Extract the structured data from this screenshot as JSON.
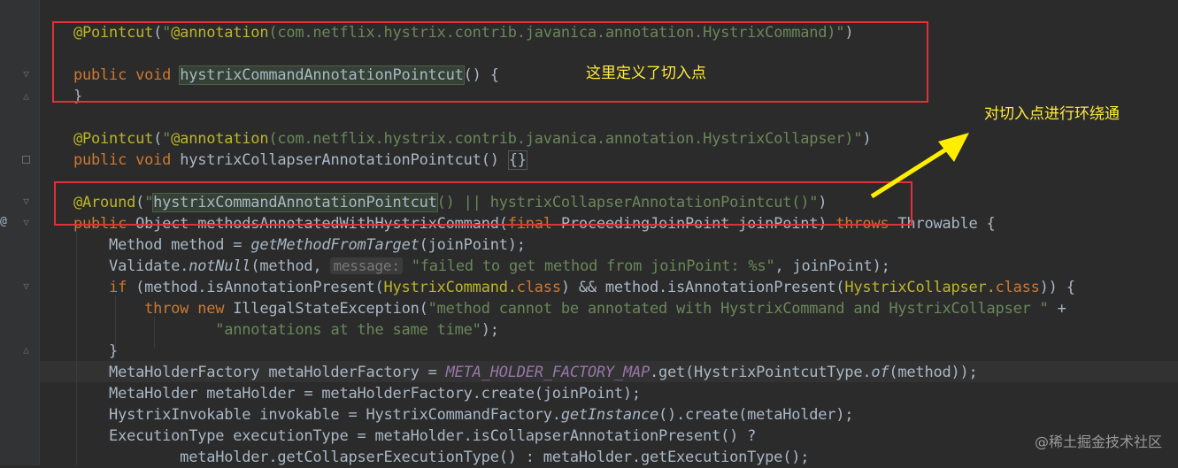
{
  "editor": {
    "gutter_marker": "@",
    "lines": [
      {
        "id": "l1",
        "tokens": [
          {
            "t": "@Pointcut",
            "c": "ann"
          },
          {
            "t": "(",
            "c": ""
          },
          {
            "t": "\"",
            "c": "str"
          },
          {
            "t": "@annotation",
            "c": "ann"
          },
          {
            "t": "(com.netflix.hystrix.contrib.javanica.annotation.HystrixCommand)",
            "c": "str"
          },
          {
            "t": "\"",
            "c": "str"
          },
          {
            "t": ")",
            "c": ""
          }
        ]
      },
      {
        "id": "l3",
        "tokens": [
          {
            "t": "public void ",
            "c": "kw"
          },
          {
            "t": "hystrixCommandAnnotationPointcut",
            "c": "hl"
          },
          {
            "t": "() {",
            "c": ""
          }
        ]
      },
      {
        "id": "l4",
        "tokens": [
          {
            "t": "}",
            "c": ""
          }
        ]
      },
      {
        "id": "l6",
        "tokens": [
          {
            "t": "@Pointcut",
            "c": "ann"
          },
          {
            "t": "(",
            "c": ""
          },
          {
            "t": "\"",
            "c": "str"
          },
          {
            "t": "@annotation",
            "c": "ann"
          },
          {
            "t": "(com.netflix.hystrix.contrib.javanica.annotation.HystrixCollapser)",
            "c": "str"
          },
          {
            "t": "\"",
            "c": "str"
          },
          {
            "t": ")",
            "c": ""
          }
        ]
      },
      {
        "id": "l7",
        "tokens": [
          {
            "t": "public void ",
            "c": "kw"
          },
          {
            "t": "hystrixCollapserAnnotationPointcut() ",
            "c": ""
          },
          {
            "t": "{}",
            "c": "brace"
          }
        ]
      },
      {
        "id": "l9",
        "tokens": [
          {
            "t": "@Around",
            "c": "ann"
          },
          {
            "t": "(",
            "c": ""
          },
          {
            "t": "\"",
            "c": "str"
          },
          {
            "t": "hystrixCommandAnnotationPointcut",
            "c": "hl"
          },
          {
            "t": "() || hystrixCollapserAnnotationPointcut()",
            "c": "str"
          },
          {
            "t": "\"",
            "c": "str"
          },
          {
            "t": ")",
            "c": ""
          }
        ]
      },
      {
        "id": "l10",
        "tokens": [
          {
            "t": "public ",
            "c": "kw"
          },
          {
            "t": "Object methodsAnnotatedWithHystrixCommand(",
            "c": ""
          },
          {
            "t": "final ",
            "c": "kw"
          },
          {
            "t": "ProceedingJoinPoint joinPoint) ",
            "c": ""
          },
          {
            "t": "throws ",
            "c": "kw"
          },
          {
            "t": "Throwable {",
            "c": ""
          }
        ]
      },
      {
        "id": "l11",
        "tokens": [
          {
            "t": "    Method method = ",
            "c": ""
          },
          {
            "t": "getMethodFromTarget",
            "c": "ital"
          },
          {
            "t": "(joinPoint);",
            "c": ""
          }
        ]
      },
      {
        "id": "l12",
        "tokens": [
          {
            "t": "    Validate.",
            "c": ""
          },
          {
            "t": "notNull",
            "c": "ital"
          },
          {
            "t": "(method, ",
            "c": ""
          },
          {
            "t": "message:",
            "c": "hint"
          },
          {
            "t": " ",
            "c": ""
          },
          {
            "t": "\"failed to get method from joinPoint: %s\"",
            "c": "str"
          },
          {
            "t": ", joinPoint);",
            "c": ""
          }
        ]
      },
      {
        "id": "l13",
        "tokens": [
          {
            "t": "    ",
            "c": ""
          },
          {
            "t": "if ",
            "c": "kw"
          },
          {
            "t": "(method.isAnnotationPresent(",
            "c": ""
          },
          {
            "t": "HystrixCommand.",
            "c": "ann"
          },
          {
            "t": "class",
            "c": "kw"
          },
          {
            "t": ") && method.isAnnotationPresent(",
            "c": ""
          },
          {
            "t": "HystrixCollapser.",
            "c": "ann"
          },
          {
            "t": "class",
            "c": "kw"
          },
          {
            "t": ")) {",
            "c": ""
          }
        ]
      },
      {
        "id": "l14",
        "tokens": [
          {
            "t": "        ",
            "c": ""
          },
          {
            "t": "throw new ",
            "c": "kw"
          },
          {
            "t": "IllegalStateException(",
            "c": ""
          },
          {
            "t": "\"method cannot be annotated with HystrixCommand and HystrixCollapser \"",
            "c": "str"
          },
          {
            "t": " +",
            "c": ""
          }
        ]
      },
      {
        "id": "l15",
        "tokens": [
          {
            "t": "                ",
            "c": ""
          },
          {
            "t": "\"annotations at the same time\"",
            "c": "str"
          },
          {
            "t": ");",
            "c": ""
          }
        ]
      },
      {
        "id": "l16",
        "tokens": [
          {
            "t": "    }",
            "c": ""
          }
        ]
      },
      {
        "id": "l17",
        "tokens": [
          {
            "t": "    MetaHolderFactory metaHolderFactory ",
            "c": ""
          },
          {
            "t": "= ",
            "c": ""
          },
          {
            "t": "META_HOLDER_FACTORY_MAP",
            "c": "const"
          },
          {
            "t": ".get(HystrixPointcutType.",
            "c": ""
          },
          {
            "t": "of",
            "c": "ital"
          },
          {
            "t": "(method));",
            "c": ""
          }
        ]
      },
      {
        "id": "l18",
        "tokens": [
          {
            "t": "    MetaHolder metaHolder = metaHolderFactory.create(joinPoint);",
            "c": ""
          }
        ]
      },
      {
        "id": "l19",
        "tokens": [
          {
            "t": "    HystrixInvokable invokable = HystrixCommandFactory.",
            "c": ""
          },
          {
            "t": "getInstance",
            "c": "ital"
          },
          {
            "t": "().create(metaHolder);",
            "c": ""
          }
        ]
      },
      {
        "id": "l20",
        "tokens": [
          {
            "t": "    ExecutionType executionType = metaHolder.isCollapserAnnotationPresent() ?",
            "c": ""
          }
        ]
      },
      {
        "id": "l21",
        "tokens": [
          {
            "t": "            metaHolder.getCollapserExecutionType() : metaHolder.getExecutionType();",
            "c": ""
          }
        ]
      }
    ]
  },
  "annotations": {
    "note_pointcut": "这里定义了切入点",
    "note_around": "对切入点进行环绕通",
    "arrow_color": "#ffee00",
    "box_color": "#e0303a"
  },
  "watermark": "@稀土掘金技术社区"
}
